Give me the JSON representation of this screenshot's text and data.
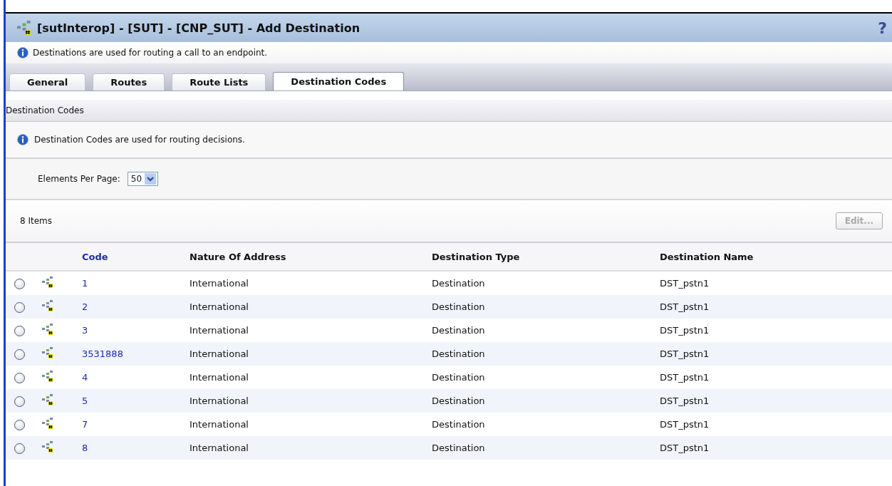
{
  "window": {
    "title": "[sutInterop] - [SUT] - [CNP_SUT] - Add Destination",
    "help": "?"
  },
  "info": "Destinations are used for routing a call to an endpoint.",
  "tabs": [
    {
      "label": "General",
      "selected": false
    },
    {
      "label": "Routes",
      "selected": false
    },
    {
      "label": "Route Lists",
      "selected": false
    },
    {
      "label": "Destination Codes",
      "selected": true
    }
  ],
  "section": {
    "title": "Destination Codes",
    "info": "Destination Codes are used for routing decisions.",
    "elements_per_page": {
      "label": "Elements Per Page:",
      "value": "50"
    },
    "count": "8 Items",
    "edit_button": {
      "label": "Edit...",
      "disabled": true
    }
  },
  "table": {
    "columns": [
      "Code",
      "Nature Of Address",
      "Destination Type",
      "Destination Name"
    ],
    "rows": [
      {
        "selected": false,
        "code": "1",
        "nature": "International",
        "type": "Destination",
        "name": "DST_pstn1"
      },
      {
        "selected": false,
        "code": "2",
        "nature": "International",
        "type": "Destination",
        "name": "DST_pstn1"
      },
      {
        "selected": false,
        "code": "3",
        "nature": "International",
        "type": "Destination",
        "name": "DST_pstn1"
      },
      {
        "selected": false,
        "code": "3531888",
        "nature": "International",
        "type": "Destination",
        "name": "DST_pstn1"
      },
      {
        "selected": false,
        "code": "4",
        "nature": "International",
        "type": "Destination",
        "name": "DST_pstn1"
      },
      {
        "selected": false,
        "code": "5",
        "nature": "International",
        "type": "Destination",
        "name": "DST_pstn1"
      },
      {
        "selected": false,
        "code": "7",
        "nature": "International",
        "type": "Destination",
        "name": "DST_pstn1"
      },
      {
        "selected": false,
        "code": "8",
        "nature": "International",
        "type": "Destination",
        "name": "DST_pstn1"
      }
    ]
  }
}
